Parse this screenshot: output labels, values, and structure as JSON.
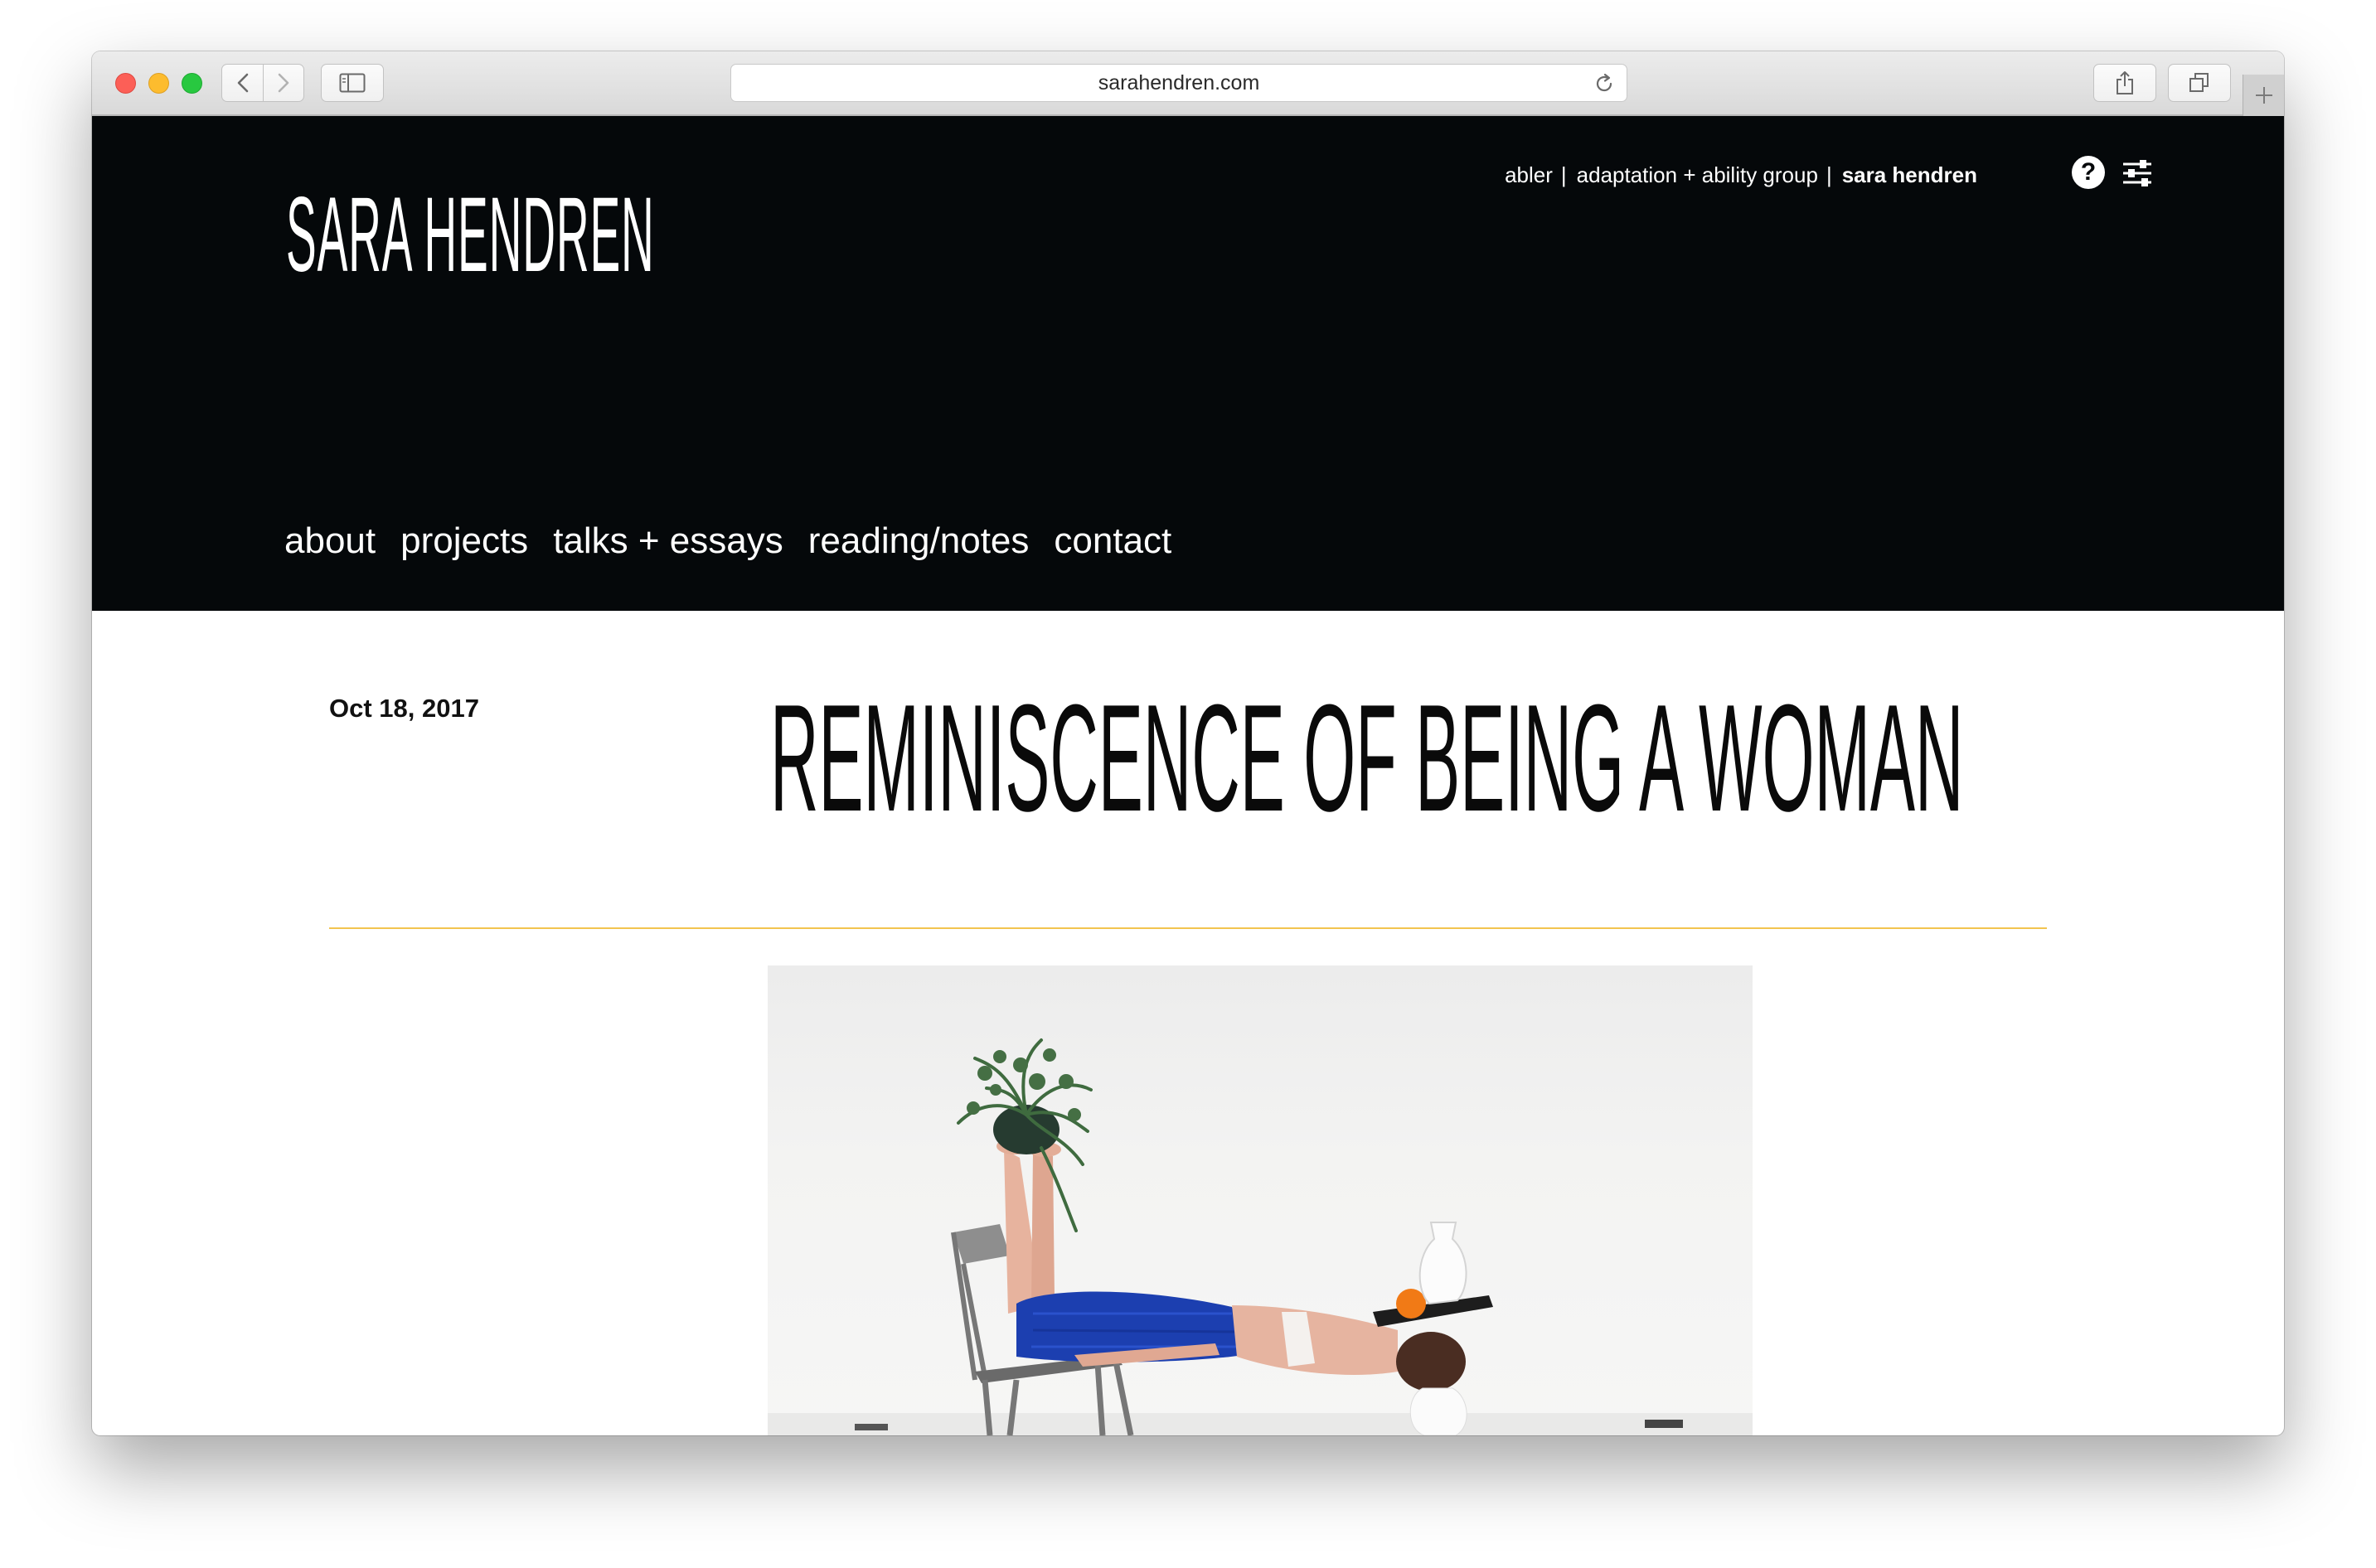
{
  "browser": {
    "url": "sarahendren.com",
    "icons": {
      "back": "chevron-left-icon",
      "forward": "chevron-right-icon",
      "sidebar": "sidebar-icon",
      "reload": "reload-icon",
      "share": "share-icon",
      "tabs": "tabs-icon",
      "new_tab": "plus-icon"
    }
  },
  "site": {
    "logo": "SARA HENDREN",
    "top_nav": {
      "items": [
        {
          "label": "abler",
          "separator": "|"
        },
        {
          "label": "adaptation + ability group",
          "separator": "|"
        },
        {
          "label": "sara hendren",
          "current": true
        }
      ],
      "help_label": "?",
      "icons": [
        "help-icon",
        "settings-sliders-icon"
      ]
    },
    "main_nav": {
      "items": [
        "about",
        "projects",
        "talks + essays",
        "reading/notes",
        "contact"
      ]
    }
  },
  "post": {
    "date": "Oct 18, 2017",
    "title": "REMINISCENCE OF BEING A WOMAN",
    "rule_color": "#f2c44f",
    "image": {
      "subject": "woman-balancing-objects-photo"
    }
  },
  "colors": {
    "header_bg": "#05080a",
    "accent": "#f2c44f"
  }
}
